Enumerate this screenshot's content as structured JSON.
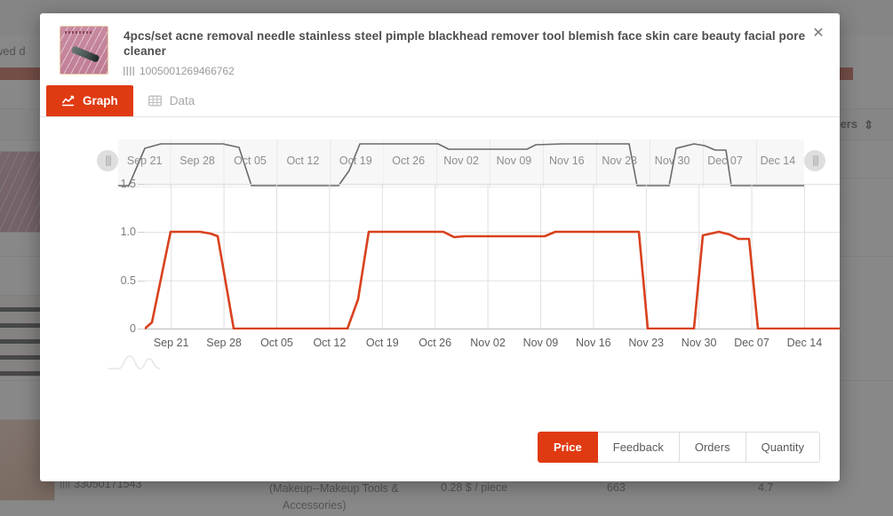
{
  "background": {
    "filter_text": "rrowed d",
    "column_header_orders": "Orders",
    "rows": [
      {
        "id": "33050171543",
        "category": "(Makeup--Makeup Tools &",
        "category2": "Accessories)",
        "price": "0.28 $ / piece",
        "orders": "663",
        "rating": "4.7"
      }
    ]
  },
  "modal": {
    "close_label": "✕",
    "product": {
      "title": "4pcs/set acne removal needle stainless steel pimple blackhead remover tool blemish face skin care beauty facial pore cleaner",
      "id": "1005001269466762",
      "thumbnail_alt": "product-thumbnail"
    },
    "tabs": [
      {
        "key": "graph",
        "label": "Graph",
        "icon": "line-chart-icon",
        "active": true
      },
      {
        "key": "data",
        "label": "Data",
        "icon": "table-grid-icon",
        "active": false
      }
    ],
    "metric_buttons": [
      {
        "label": "Price",
        "active": true
      },
      {
        "label": "Feedback",
        "active": false
      },
      {
        "label": "Orders",
        "active": false
      },
      {
        "label": "Quantity",
        "active": false
      }
    ],
    "colors": {
      "accent": "#e03a12",
      "series": "#d9411e",
      "navigator_series": "#6b6b6b",
      "grid": "#e0e0e0"
    }
  },
  "chart_data": {
    "type": "line",
    "title": "",
    "xlabel": "",
    "ylabel": "",
    "ylim": [
      0,
      1.65
    ],
    "yticks": [
      0,
      0.5,
      1.0,
      1.5
    ],
    "ytick_labels": [
      "0",
      "0.5",
      "1.0",
      "1.5"
    ],
    "grid": true,
    "legend": false,
    "categories": [
      "Sep 21",
      "Sep 28",
      "Oct 05",
      "Oct 12",
      "Oct 19",
      "Oct 26",
      "Nov 02",
      "Nov 09",
      "Nov 16",
      "Nov 23",
      "Nov 30",
      "Dec 07",
      "Dec 14"
    ],
    "series": [
      {
        "name": "Price",
        "color": "#d9411e",
        "x": [
          "Sep 17",
          "Sep 19",
          "Sep 21",
          "Sep 24",
          "Sep 27",
          "Sep 28",
          "Sep 30",
          "Oct 02",
          "Oct 05",
          "Oct 08",
          "Oct 12",
          "Oct 14",
          "Oct 16",
          "Oct 19",
          "Oct 22",
          "Oct 25",
          "Oct 26",
          "Oct 28",
          "Oct 31",
          "Nov 02",
          "Nov 05",
          "Nov 07",
          "Nov 09",
          "Nov 12",
          "Nov 16",
          "Nov 19",
          "Nov 21",
          "Nov 22",
          "Nov 23",
          "Nov 25",
          "Nov 27",
          "Nov 28",
          "Nov 30",
          "Dec 01",
          "Dec 02",
          "Dec 04",
          "Dec 07",
          "Dec 11",
          "Dec 14",
          "Dec 17"
        ],
        "values": [
          0.0,
          0.55,
          1.0,
          1.0,
          1.0,
          1.0,
          0.95,
          0.0,
          0.0,
          0.0,
          0.0,
          0.3,
          1.0,
          1.0,
          1.0,
          1.0,
          1.0,
          0.98,
          0.95,
          0.95,
          0.95,
          0.95,
          1.0,
          1.0,
          1.0,
          1.0,
          1.0,
          0.55,
          0.0,
          0.0,
          0.0,
          0.55,
          1.0,
          1.0,
          0.97,
          0.95,
          0.0,
          0.0,
          0.0,
          0.0
        ]
      }
    ],
    "navigator": {
      "type": "line",
      "color": "#6b6b6b",
      "selected_range": [
        "Sep 17",
        "Dec 17"
      ],
      "values": [
        0.0,
        0.55,
        1.0,
        1.0,
        1.0,
        1.0,
        0.95,
        0.0,
        0.0,
        0.0,
        0.0,
        0.3,
        1.0,
        1.0,
        1.0,
        1.0,
        1.0,
        0.95,
        0.95,
        0.95,
        0.95,
        0.95,
        1.0,
        1.0,
        1.0,
        1.0,
        1.0,
        0.55,
        0.0,
        0.0,
        0.0,
        0.55,
        1.0,
        1.0,
        0.97,
        0.95,
        0.0,
        0.0,
        0.0,
        0.0
      ],
      "tick_labels": [
        "Sep 21",
        "Sep 28",
        "Oct 05",
        "Oct 12",
        "Oct 19",
        "Oct 26",
        "Nov 02",
        "Nov 09",
        "Nov 16",
        "Nov 23",
        "Nov 30",
        "Dec 07",
        "Dec 14"
      ]
    }
  }
}
